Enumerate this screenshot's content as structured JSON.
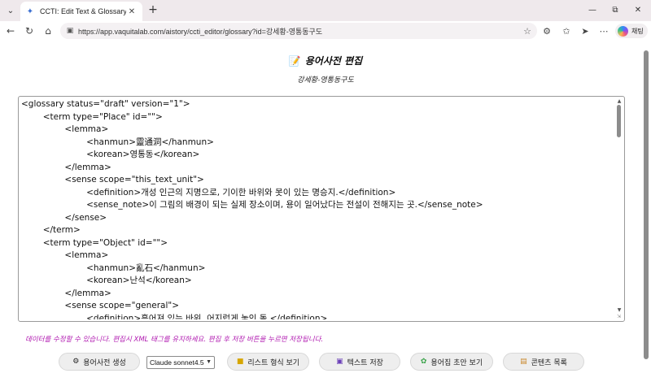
{
  "browser": {
    "tab_title": "CCTI: Edit Text & Glossary",
    "url": "https://app.vaquitalab.com/aistory/ccti_editor/glossary?id=강세황-영통동구도",
    "copilot_label": "채팅",
    "icons": {
      "tab_list": "chevron-down-icon",
      "favicon": "feather-icon",
      "tab_close": "close-icon",
      "new_tab": "plus-icon",
      "minimize": "minimize-icon",
      "restore": "restore-icon",
      "close_window": "close-icon",
      "back": "back-arrow-icon",
      "refresh": "refresh-icon",
      "home": "home-icon",
      "site_info": "site-info-icon",
      "favorite": "star-icon",
      "extensions": "puzzle-icon",
      "favorites_bar": "favorites-icon",
      "pin": "pin-icon",
      "more": "more-icon"
    }
  },
  "page": {
    "title": "용어사전 편집",
    "title_icon": "memo-icon",
    "subtitle": "강세황-영통동구도",
    "editor_text": "<glossary status=\"draft\" version=\"1\">\n\t<term type=\"Place\" id=\"\">\n\t\t<lemma>\n\t\t\t<hanmun>靈通洞</hanmun>\n\t\t\t<korean>영통동</korean>\n\t\t</lemma>\n\t\t<sense scope=\"this_text_unit\">\n\t\t\t<definition>개성 인근의 지명으로, 기이한 바위와 못이 있는 명승지.</definition>\n\t\t\t<sense_note>이 그림의 배경이 되는 실제 장소이며, 용이 일어났다는 전설이 전해지는 곳.</sense_note>\n\t\t</sense>\n\t</term>\n\t<term type=\"Object\" id=\"\">\n\t\t<lemma>\n\t\t\t<hanmun>亂石</hanmun>\n\t\t\t<korean>난석</korean>\n\t\t</lemma>\n\t\t<sense scope=\"general\">\n\t\t\t<definition>흩어져 있는 바위, 어지럽게 놓인 돌.</definition>",
    "hint": "데이터를 수정할 수 있습니다. 편집시 XML 태그를 유지하세요. 편집 후 저장 버튼을 누르면 저장됩니다."
  },
  "actions": {
    "generate": {
      "label": "용어사전 생성",
      "icon": "robot-icon"
    },
    "model_select": {
      "value": "Claude sonnet4.5"
    },
    "list_view": {
      "label": "리스트 형식 보기",
      "icon": "note-icon"
    },
    "save_text": {
      "label": "텍스트 저장",
      "icon": "floppy-disk-icon"
    },
    "draft_view": {
      "label": "용어집 초안 보기",
      "icon": "sprout-icon"
    },
    "content_list": {
      "label": "콘텐츠 목록",
      "icon": "scroll-icon"
    }
  },
  "colors": {
    "hint": "#b019b0",
    "tab_strip": "#efe9ec",
    "button_bg": "#eeeeee"
  }
}
